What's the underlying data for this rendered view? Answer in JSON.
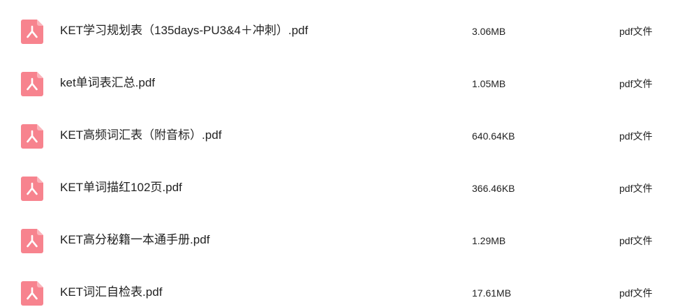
{
  "colors": {
    "icon_background": "#F7838E",
    "icon_fold": "#FBB4BB",
    "text": "#222222",
    "background": "#FFFFFF"
  },
  "files": [
    {
      "name": "KET学习规划表（135days-PU3&4＋冲刺）.pdf",
      "size": "3.06MB",
      "type": "pdf文件",
      "icon": "pdf-file-icon"
    },
    {
      "name": "ket单词表汇总.pdf",
      "size": "1.05MB",
      "type": "pdf文件",
      "icon": "pdf-file-icon"
    },
    {
      "name": "KET高频词汇表（附音标）.pdf",
      "size": "640.64KB",
      "type": "pdf文件",
      "icon": "pdf-file-icon"
    },
    {
      "name": "KET单词描红102页.pdf",
      "size": "366.46KB",
      "type": "pdf文件",
      "icon": "pdf-file-icon"
    },
    {
      "name": "KET高分秘籍一本通手册.pdf",
      "size": "1.29MB",
      "type": "pdf文件",
      "icon": "pdf-file-icon"
    },
    {
      "name": "KET词汇自检表.pdf",
      "size": "17.61MB",
      "type": "pdf文件",
      "icon": "pdf-file-icon"
    }
  ]
}
